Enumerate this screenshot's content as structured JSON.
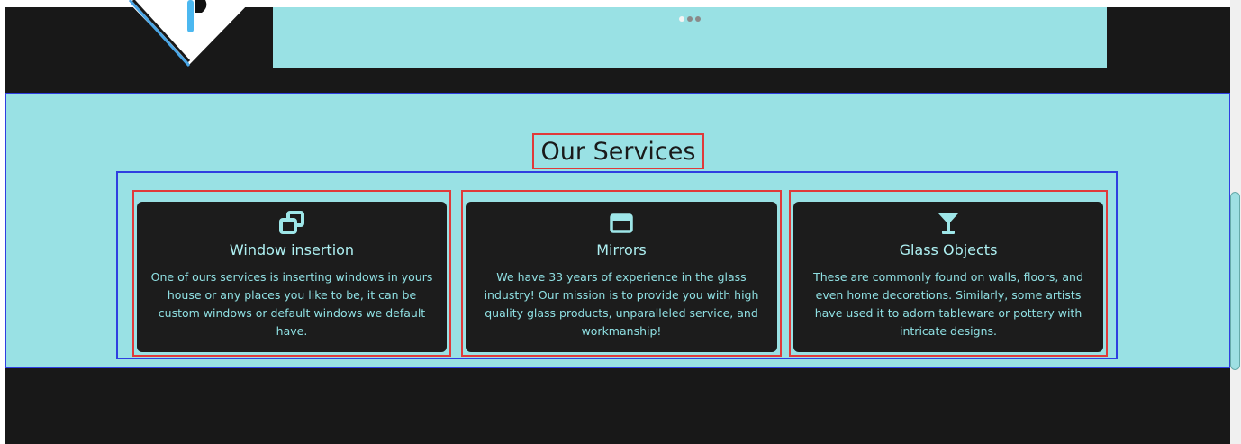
{
  "slider": {
    "dot_count": 3,
    "active_dot_index": 0
  },
  "services": {
    "title": "Our Services",
    "items": [
      {
        "icon": "windows-stack-icon",
        "title": "Window insertion",
        "description": "One of ours services is inserting windows in yours house or any places you like to be, it can be custom windows or default windows we default have."
      },
      {
        "icon": "window-frame-icon",
        "title": "Mirrors",
        "description": "We have 33 years of experience in the glass industry! Our mission is to provide you with high quality glass products, unparalleled service, and workmanship!"
      },
      {
        "icon": "cocktail-glass-icon",
        "title": "Glass Objects",
        "description": "These are commonly found on walls, floors, and even home decorations. Similarly, some artists have used it to adorn tableware or pottery with intricate designs."
      }
    ]
  },
  "colors": {
    "page_background": "#181818",
    "section_background": "#99e1e4",
    "card_background": "#1c1c1c",
    "card_text": "#9ee6e8",
    "outline_blue": "#2f3fe0",
    "outline_red": "#e03a3a"
  }
}
